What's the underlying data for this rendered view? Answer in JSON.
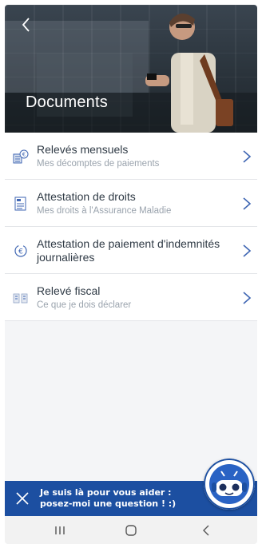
{
  "header": {
    "title": "Documents"
  },
  "documents": [
    {
      "title": "Relevés mensuels",
      "subtitle": "Mes décomptes de paiements",
      "icon": "monthly-statement-icon"
    },
    {
      "title": "Attestation de droits",
      "subtitle": "Mes droits à l'Assurance Maladie",
      "icon": "rights-certificate-icon"
    },
    {
      "title": "Attestation de paiement d'indemnités journalières",
      "subtitle": "",
      "icon": "daily-allowance-icon"
    },
    {
      "title": "Relevé fiscal",
      "subtitle": "Ce que je dois déclarer",
      "icon": "tax-statement-icon"
    }
  ],
  "chat": {
    "line1": "Je suis là pour vous aider :",
    "line2": "posez-moi une question ! :)"
  },
  "colors": {
    "accent": "#1c4fa1",
    "chevron": "#3f66b3"
  }
}
